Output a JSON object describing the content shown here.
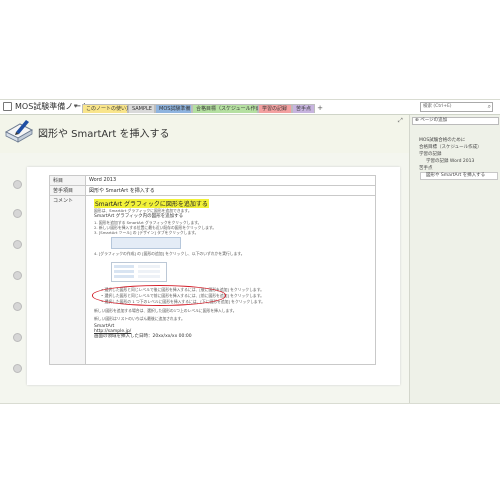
{
  "notebook": {
    "title": "MOS試験準備ノート",
    "arrow": "▾"
  },
  "tabs": [
    {
      "label": "このノートの使い方",
      "color": "#f9e58b"
    },
    {
      "label": "SAMPLE",
      "color": "#d9d9d9"
    },
    {
      "label": "MOS試験準備",
      "color": "#8fb4df"
    },
    {
      "label": "合格目標（スケジュール作成）",
      "color": "#b5e0a1"
    },
    {
      "label": "学習の記録",
      "color": "#f3a0a0"
    },
    {
      "label": "苦手点",
      "color": "#c7b4df"
    }
  ],
  "tabs_add": "+",
  "search": {
    "placeholder": "検索 (Ctrl+E)"
  },
  "page": {
    "title": "図形や SmartArt を挿入する",
    "table": [
      {
        "key": "科目",
        "value": "Word 2013"
      },
      {
        "key": "苦手項目",
        "value": "図形や SmartArt を挿入する"
      },
      {
        "key": "コメント",
        "value": ""
      }
    ],
    "comment": {
      "heading": "SmartArt グラフィックに図形を追加する",
      "lines": [
        "図形は、SmartArt グラフィックに図形を追加できます。",
        "SmartArt グラフィック内の図形を追加する",
        "1. 図形を追加する SmartArt グラフィックをクリックします。",
        "2. 新しい図形を挿入する位置に最も近い既存の図形をクリックします。",
        "3. [SmartArt ツール] の [デザイン] タブをクリックします。",
        "4. [グラフィックの作成] の [図形の追加] をクリックし、以下のいずれかを実行します。",
        "• 選択した図形と同じレベルで後に図形を挿入するには、[後に図形を追加] をクリックします。",
        "• 選択した図形と同じレベルで前に図形を挿入するには、[前に図形を追加] をクリックします。",
        "• 選択した図形の 1 つ下のレベルに図形を挿入するには、[下に図形を追加] をクリックします。",
        "新しい図形を追加する場合は、選択した図形の1つ上のレベルに図形を挿入します。",
        "新しい図形はリストのいちばん最後に追加されます。",
        "SmartArt",
        "http://sample.jp/",
        "画面の領域を挿入した日時：20xx/xx/xx 00:00"
      ]
    }
  },
  "pages_pane": {
    "add_label": "ページの追加",
    "items": [
      "MOS試験合格のために",
      "合格目標（スケジュール作成）",
      "学習の記録",
      "学習の記録 Word 2013",
      "苦手点",
      "図形や SmartArt を挿入する"
    ]
  }
}
